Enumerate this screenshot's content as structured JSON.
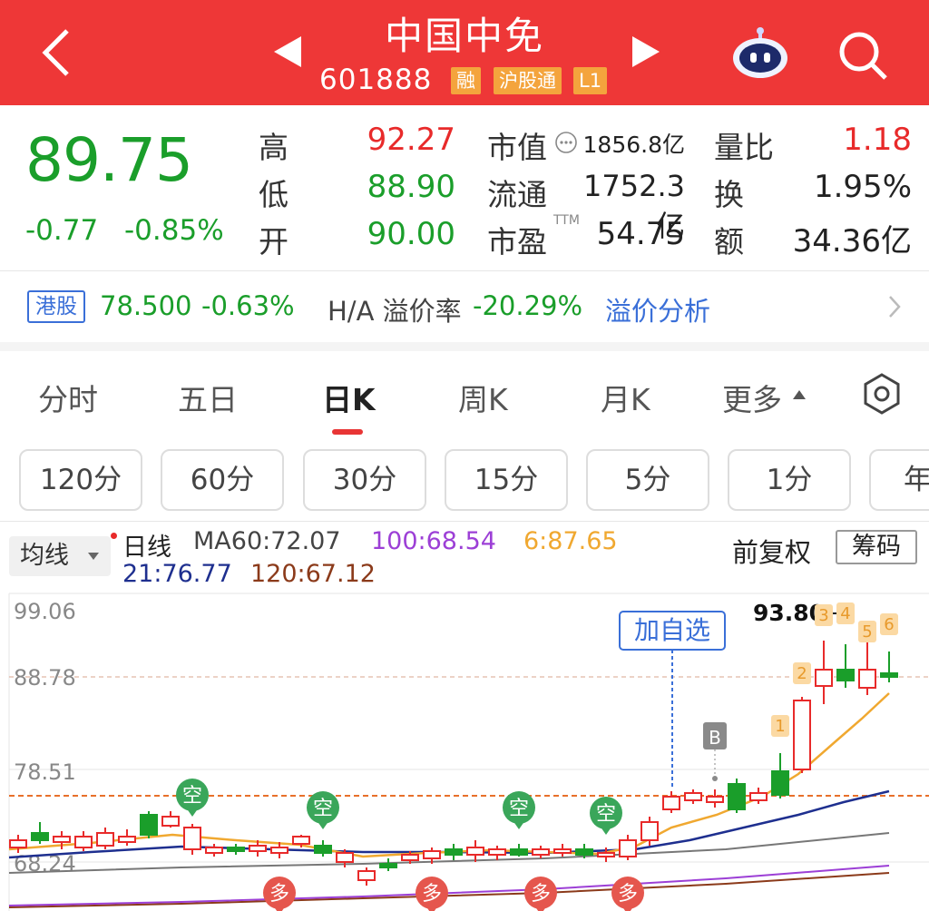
{
  "header": {
    "title": "中国中免",
    "code": "601888",
    "tags": [
      "融",
      "沪股通",
      "L1"
    ]
  },
  "quote": {
    "price": "89.75",
    "change": "-0.77",
    "change_pct": "-0.85%",
    "high_label": "高",
    "high": "92.27",
    "low_label": "低",
    "low": "88.90",
    "open_label": "开",
    "open": "90.00",
    "mktcap_label": "市值",
    "mktcap": "1856.8亿",
    "float_label": "流通",
    "float": "1752.3亿",
    "pe_label": "市盈",
    "pe_sup": "TTM",
    "pe": "54.75",
    "vol_ratio_label": "量比",
    "vol_ratio": "1.18",
    "turnover_label": "换",
    "turnover": "1.95%",
    "amount_label": "额",
    "amount": "34.36亿"
  },
  "hk": {
    "badge": "港股",
    "price": "78.500",
    "pct": "-0.63%",
    "premium_label": "H/A 溢价率",
    "premium": "-20.29%",
    "link": "溢价分析"
  },
  "tabs": [
    "分时",
    "五日",
    "日K",
    "周K",
    "月K",
    "更多"
  ],
  "periods": [
    "120分",
    "60分",
    "30分",
    "15分",
    "5分",
    "1分",
    "年"
  ],
  "ma": {
    "button": "均线",
    "day": "日线",
    "ma60": "MA60:72.07",
    "ma100": "100:68.54",
    "ma6": "6:87.65",
    "ma21": "21:76.77",
    "ma120": "120:67.12",
    "fq": "前复权",
    "chip": "筹码"
  },
  "chart_data": {
    "type": "candlestick",
    "y_labels": [
      "99.06",
      "88.78",
      "78.51",
      "68.24"
    ],
    "max_marker": "93.80",
    "add_watch": "加自选",
    "buy_marker": "B",
    "short_marker": "空",
    "long_marker": "多",
    "counters": [
      "1",
      "2",
      "3",
      "4",
      "5",
      "6"
    ],
    "ylim": [
      66.5,
      100
    ]
  },
  "colors": {
    "header": "#ee3737",
    "up": "#e82a2a",
    "down": "#1a9e2a",
    "ma6": "#f0a830",
    "ma21": "#1e2f8f",
    "ma60": "#777777",
    "ma100": "#9c3fd6",
    "ma120": "#8b3a1a"
  }
}
